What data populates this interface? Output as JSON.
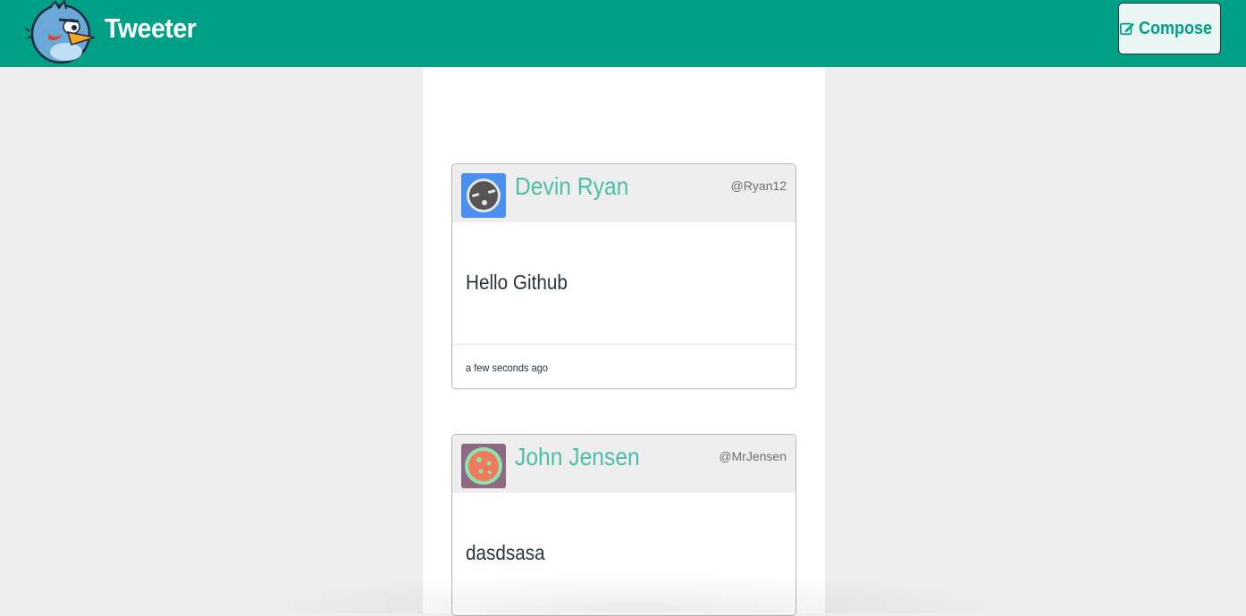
{
  "header": {
    "brand": "Tweeter",
    "compose_label": "Compose",
    "logo_icon": "blue-bird-logo-icon",
    "compose_icon": "edit-icon"
  },
  "tweets": [
    {
      "name": "Devin Ryan",
      "handle": "@Ryan12",
      "text": "Hello Github",
      "time": "a few seconds ago",
      "avatar_icon": "robot-face-avatar"
    },
    {
      "name": "John Jensen",
      "handle": "@MrJensen",
      "text": "dasdsasa",
      "time": "",
      "avatar_icon": "pizza-avatar"
    }
  ],
  "colors": {
    "nav": "#00a087",
    "accent": "#4dbfa4",
    "page_bg": "#eeeeee"
  }
}
